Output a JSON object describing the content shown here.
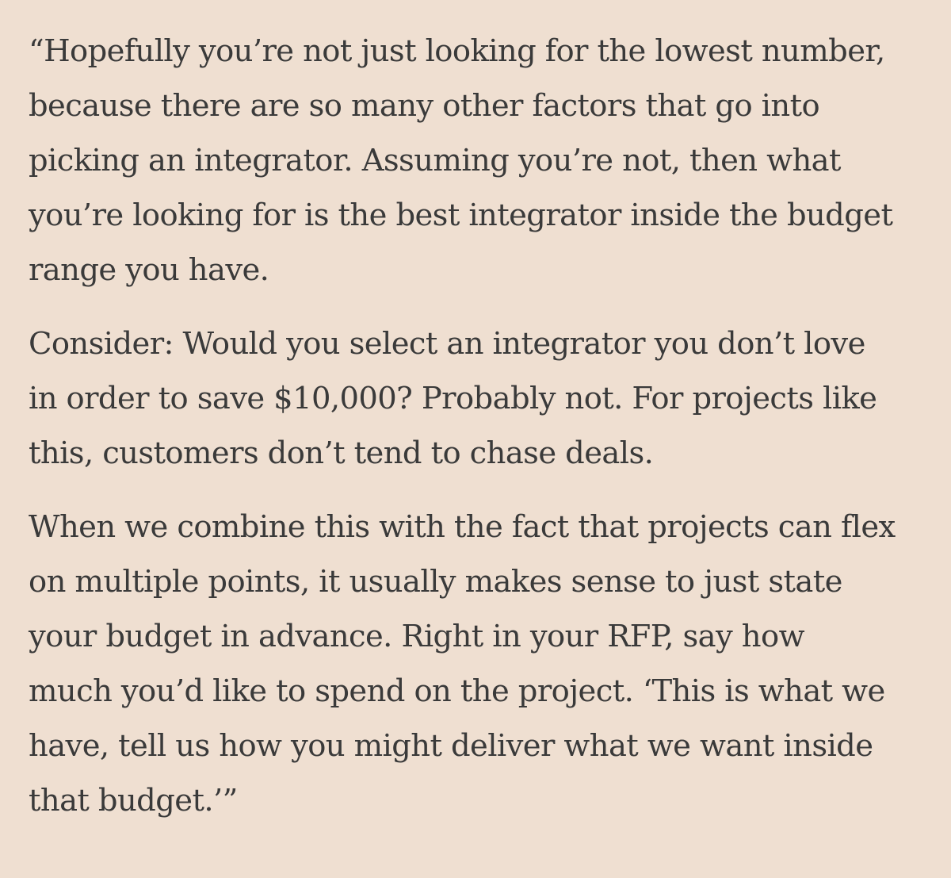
{
  "article": {
    "paragraphs": [
      {
        "lines": [
          "“Hopefully you’re not just looking for the lowest number,",
          "because there are so many other factors that go into",
          "picking an integrator. Assuming you’re not, then what",
          "you’re looking for is the best integrator inside the budget",
          "range you have."
        ]
      },
      {
        "lines": [
          "Consider: Would you select an integrator you don’t love",
          "in order to save $10,000? Probably not. For projects like",
          "this, customers don’t tend to chase deals."
        ]
      },
      {
        "lines": [
          "When we combine this with the fact that projects can flex",
          "on multiple points, it usually makes sense to just state",
          "your budget in advance. Right in your RFP, say how",
          "much you’d like to spend on the project. ‘This is what we",
          "have, tell us how you might deliver what we want inside",
          "that budget.’”"
        ]
      }
    ]
  },
  "colors": {
    "background": "#efdfd1",
    "text": "#3a3a3a"
  }
}
